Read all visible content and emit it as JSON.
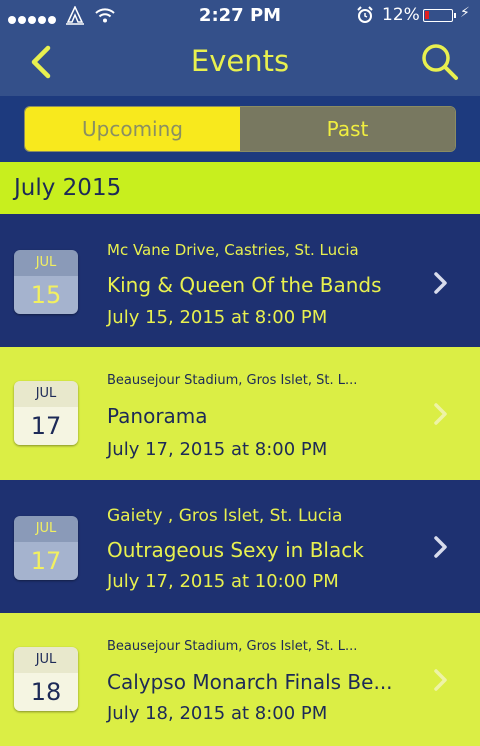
{
  "status": {
    "time": "2:27 PM",
    "battery": "12%"
  },
  "header": {
    "title": "Events"
  },
  "tabs": [
    {
      "label": "Upcoming",
      "active": true
    },
    {
      "label": "Past",
      "active": false
    }
  ],
  "section": {
    "month": "July 2015"
  },
  "events": [
    {
      "month": "JUL",
      "day": "15",
      "location": "Mc Vane Drive, Castries, St. Lucia",
      "name": "King & Queen Of the Bands",
      "date": "July 15, 2015 at 8:00 PM",
      "theme": "dark"
    },
    {
      "month": "JUL",
      "day": "17",
      "location": "Beausejour Stadium, Gros Islet, St. L...",
      "name": "Panorama",
      "date": "July 17, 2015 at 8:00 PM",
      "theme": "light"
    },
    {
      "month": "JUL",
      "day": "17",
      "location": "Gaiety , Gros Islet, St. Lucia",
      "name": "Outrageous Sexy in Black",
      "date": "July 17, 2015 at 10:00 PM",
      "theme": "dark"
    },
    {
      "month": "JUL",
      "day": "18",
      "location": "Beausejour Stadium, Gros Islet, St. L...",
      "name": "Calypso Monarch Finals Be...",
      "date": "July 18, 2015 at 8:00 PM",
      "theme": "light"
    }
  ],
  "colors": {
    "accent": "#e8f04f",
    "navy": "#1e3171",
    "lime": "#c8ef1e"
  }
}
